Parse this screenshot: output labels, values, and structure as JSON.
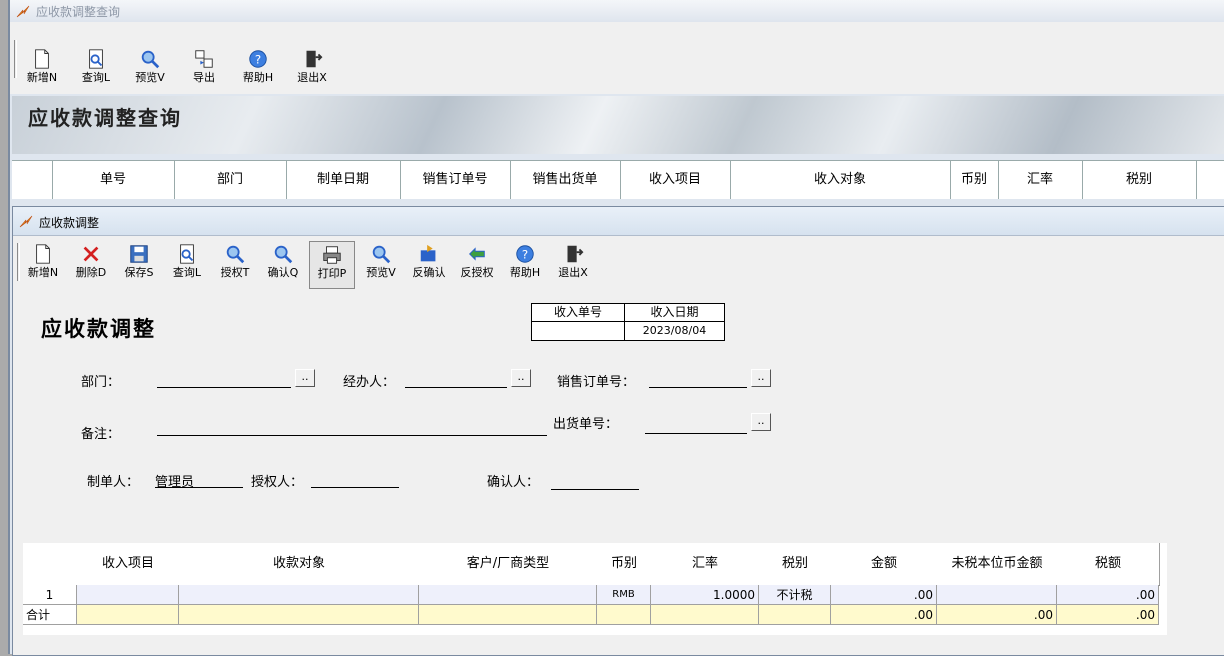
{
  "outer": {
    "title": "应收款调整查询",
    "toolbar": [
      "新增N",
      "查询L",
      "预览V",
      "导出",
      "帮助H",
      "退出X"
    ],
    "banner_title": "应收款调整查询",
    "columns": [
      "单号",
      "部门",
      "制单日期",
      "销售订单号",
      "销售出货单",
      "收入项目",
      "收入对象",
      "币别",
      "汇率",
      "税别"
    ]
  },
  "inner": {
    "title": "应收款调整",
    "toolbar": [
      "新增N",
      "删除D",
      "保存S",
      "查询L",
      "授权T",
      "确认Q",
      "打印P",
      "预览V",
      "反确认",
      "反授权",
      "帮助H",
      "退出X"
    ],
    "form_title": "应收款调整",
    "info": {
      "col1_header": "收入单号",
      "col2_header": "收入日期",
      "col1_value": "",
      "col2_value": "2023/08/04"
    },
    "form": {
      "dept_label": "部门：",
      "handler_label": "经办人：",
      "sales_order_label": "销售订单号：",
      "remark_label": "备注：",
      "ship_no_label": "出货单号：",
      "maker_label": "制单人：",
      "maker_value": "管理员",
      "auth_label": "授权人：",
      "confirm_label": "确认人："
    },
    "dots_label": "..",
    "grid": {
      "headers": [
        "",
        "收入项目",
        "收款对象",
        "客户/厂商类型",
        "币别",
        "汇率",
        "税别",
        "金额",
        "未税本位币金额",
        "税额"
      ],
      "rows": [
        [
          "1",
          "",
          "",
          "",
          "RMB",
          "1.0000",
          "不计税",
          ".00",
          "",
          ".00"
        ],
        [
          "合计",
          "",
          "",
          "",
          "",
          "",
          "",
          ".00",
          ".00",
          ".00"
        ]
      ]
    }
  },
  "colors": {
    "icon_blue": "#2a62c9",
    "icon_red": "#d42020",
    "total_row": "#fffacd"
  }
}
